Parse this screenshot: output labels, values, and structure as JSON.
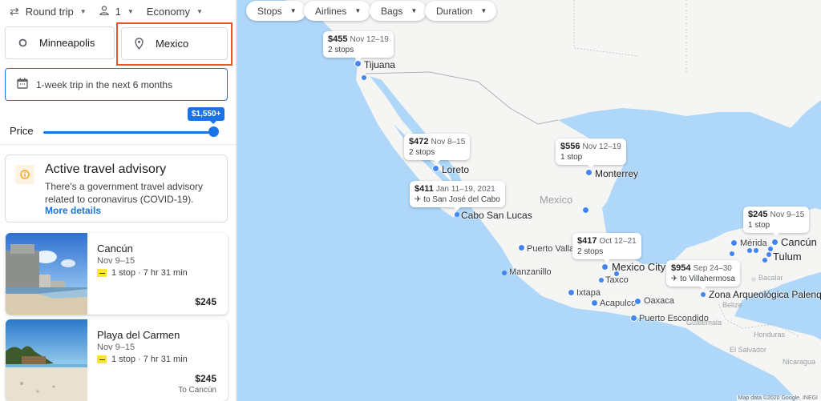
{
  "search": {
    "trip_type": "Round trip",
    "passengers": "1",
    "cabin_class": "Economy",
    "origin": "Minneapolis",
    "destination": "Mexico",
    "dates": "1-week trip in the next 6 months",
    "price_label": "Price",
    "price_max": "$1,550+",
    "price_fraction": 1.0
  },
  "advisory": {
    "title": "Active travel advisory",
    "body": "There's a government travel advisory related to coronavirus (COVID-19).",
    "link": "More details"
  },
  "results": [
    {
      "city": "Cancún",
      "dates": "Nov 9–15",
      "stops": "1 stop · 7 hr 31 min",
      "price": "$245",
      "note": ""
    },
    {
      "city": "Playa del Carmen",
      "dates": "Nov 9–15",
      "stops": "1 stop · 7 hr 31 min",
      "price": "$245",
      "note": "To Cancún"
    }
  ],
  "filters": [
    "Stops",
    "Airlines",
    "Bags",
    "Duration"
  ],
  "map": {
    "country_label": "Mexico",
    "pins": [
      {
        "price": "$455",
        "dates": "Nov 12–19",
        "detail": "2 stops",
        "flight_icon": false
      },
      {
        "price": "$472",
        "dates": "Nov 8–15",
        "detail": "2 stops",
        "flight_icon": false
      },
      {
        "price": "$556",
        "dates": "Nov 12–19",
        "detail": "1 stop",
        "flight_icon": false
      },
      {
        "price": "$411",
        "dates": "Jan 11–19, 2021",
        "detail": "to San José del Cabo",
        "flight_icon": true
      },
      {
        "price": "$417",
        "dates": "Oct 12–21",
        "detail": "2 stops",
        "flight_icon": false
      },
      {
        "price": "$954",
        "dates": "Sep 24–30",
        "detail": "to Villahermosa",
        "flight_icon": true
      },
      {
        "price": "$245",
        "dates": "Nov 9–15",
        "detail": "1 stop",
        "flight_icon": false
      }
    ],
    "places": [
      "Tijuana",
      "Loreto",
      "Monterrey",
      "Cabo San Lucas",
      "Puerto Vallarta",
      "Manzanillo",
      "Mexico City",
      "Taxco",
      "Ixtapa",
      "Acapulco",
      "Oaxaca",
      "Puerto Escondido",
      "Zona Arqueológica Palenque",
      "Mérida",
      "Cancún",
      "Tulum",
      "Bacalar"
    ],
    "countries": [
      "Belize",
      "Guatemala",
      "Honduras",
      "El Salvador",
      "Nicaragua"
    ],
    "attribution": "Map data ©2020 Google, INEGI"
  }
}
